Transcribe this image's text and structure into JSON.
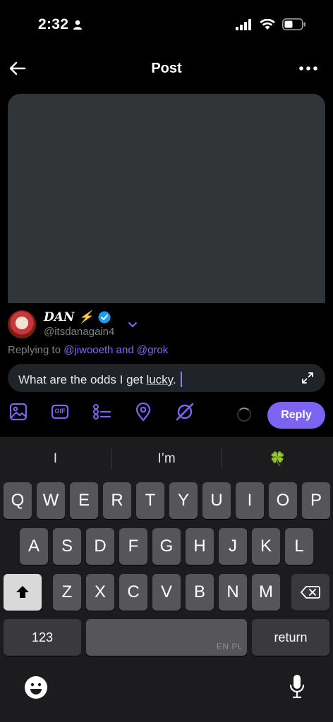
{
  "status_bar": {
    "time": "2:32"
  },
  "nav": {
    "title": "Post"
  },
  "composer": {
    "display_name": "DAN ⚡",
    "handle": "@itsdanagain4",
    "replying_prefix": "Replying to ",
    "replying_mentions": "@jiwooeth and @grok",
    "input_before": "What are the odds I get ",
    "input_underlined": "lucky",
    "input_after": ".",
    "reply_label": "Reply"
  },
  "toolbar": {
    "icons": [
      "image-icon",
      "gif-icon",
      "poll-icon",
      "location-icon",
      "grok-icon"
    ],
    "gif_label": "GIF"
  },
  "keyboard": {
    "suggestions": [
      "I",
      "I’m",
      "🍀"
    ],
    "row1": [
      "Q",
      "W",
      "E",
      "R",
      "T",
      "Y",
      "U",
      "I",
      "O",
      "P"
    ],
    "row2": [
      "A",
      "S",
      "D",
      "F",
      "G",
      "H",
      "J",
      "K",
      "L"
    ],
    "row3": [
      "Z",
      "X",
      "C",
      "V",
      "B",
      "N",
      "M"
    ],
    "numbers_label": "123",
    "space_lang": "EN PL",
    "return_label": "return"
  },
  "colors": {
    "accent": "#7c63f2",
    "link": "#7c6cf7",
    "verified": "#1d9bf0"
  }
}
